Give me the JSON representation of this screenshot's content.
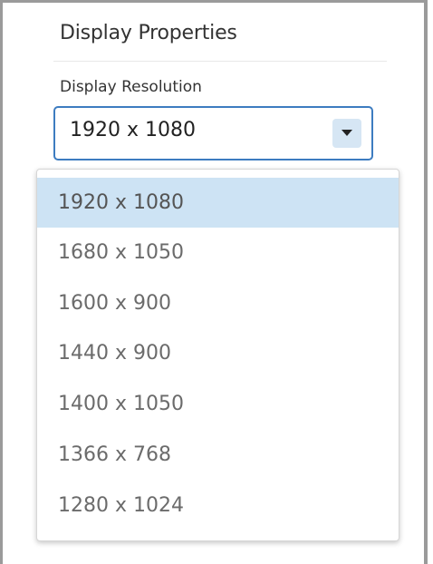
{
  "section": {
    "title": "Display Properties"
  },
  "resolution": {
    "label": "Display Resolution",
    "selected_value": "1920 x 1080",
    "options": [
      "1920 x 1080",
      "1680 x 1050",
      "1600 x 900",
      "1440 x 900",
      "1400 x 1050",
      "1366 x 768",
      "1280 x 1024"
    ],
    "selected_index": 0,
    "dropdown_open": true,
    "arrow_icon": "caret-down-icon"
  },
  "colors": {
    "select_border": "#3d7cc0",
    "arrow_background": "#d6e6f4",
    "selected_option_background": "#cde3f4",
    "option_text": "#6b6b6b"
  }
}
